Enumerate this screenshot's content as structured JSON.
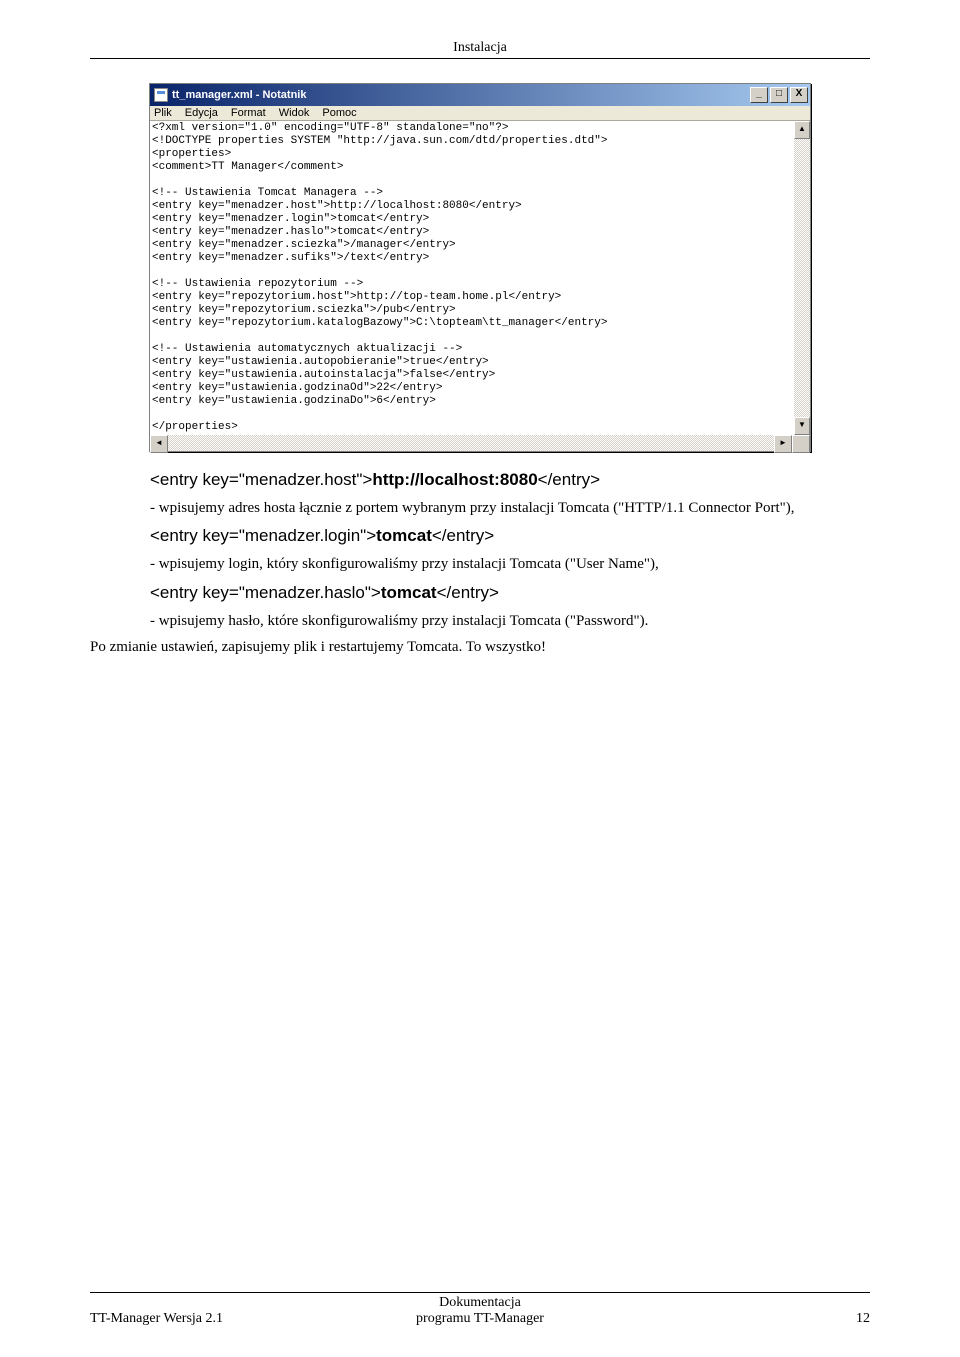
{
  "header": {
    "title": "Instalacja"
  },
  "notepad": {
    "title": "tt_manager.xml - Notatnik",
    "menu": [
      "Plik",
      "Edycja",
      "Format",
      "Widok",
      "Pomoc"
    ],
    "buttons": {
      "min": "_",
      "max": "□",
      "close": "X"
    },
    "scroll": {
      "up": "▲",
      "down": "▼",
      "left": "◄",
      "right": "►"
    },
    "content": "<?xml version=\"1.0\" encoding=\"UTF-8\" standalone=\"no\"?>\n<!DOCTYPE properties SYSTEM \"http://java.sun.com/dtd/properties.dtd\">\n<properties>\n<comment>TT Manager</comment>\n\n<!-- Ustawienia Tomcat Managera -->\n<entry key=\"menadzer.host\">http://localhost:8080</entry>\n<entry key=\"menadzer.login\">tomcat</entry>\n<entry key=\"menadzer.haslo\">tomcat</entry>\n<entry key=\"menadzer.sciezka\">/manager</entry>\n<entry key=\"menadzer.sufiks\">/text</entry>\n\n<!-- Ustawienia repozytorium -->\n<entry key=\"repozytorium.host\">http://top-team.home.pl</entry>\n<entry key=\"repozytorium.sciezka\">/pub</entry>\n<entry key=\"repozytorium.katalogBazowy\">C:\\topteam\\tt_manager</entry>\n\n<!-- Ustawienia automatycznych aktualizacji -->\n<entry key=\"ustawienia.autopobieranie\">true</entry>\n<entry key=\"ustawienia.autoinstalacja\">false</entry>\n<entry key=\"ustawienia.godzinaOd\">22</entry>\n<entry key=\"ustawienia.godzinaDo\">6</entry>\n\n</properties>"
  },
  "entries": {
    "host_prefix": "<entry key=\"menadzer.host\">",
    "host_value": "http://localhost:8080",
    "host_suffix": "</entry>",
    "login_prefix": "<entry key=\"menadzer.login\">",
    "login_value": "tomcat",
    "login_suffix": "</entry>",
    "haslo_prefix": "<entry key=\"menadzer.haslo\">",
    "haslo_value": "tomcat",
    "haslo_suffix": "</entry>"
  },
  "body": {
    "line1": "- wpisujemy adres hosta łącznie z portem wybranym przy instalacji Tomcata (\"HTTP/1.1 Connector Port\"),",
    "line2": "- wpisujemy login, który skonfigurowaliśmy przy instalacji Tomcata (\"User Name\"),",
    "line3": "- wpisujemy hasło, które skonfigurowaliśmy przy instalacji Tomcata (\"Password\").",
    "line4": "Po zmianie ustawień, zapisujemy plik i restartujemy Tomcata. To wszystko!"
  },
  "footer": {
    "left": "TT-Manager Wersja 2.1",
    "center_top": "Dokumentacja",
    "center_bottom": "programu TT-Manager",
    "right": "12"
  }
}
